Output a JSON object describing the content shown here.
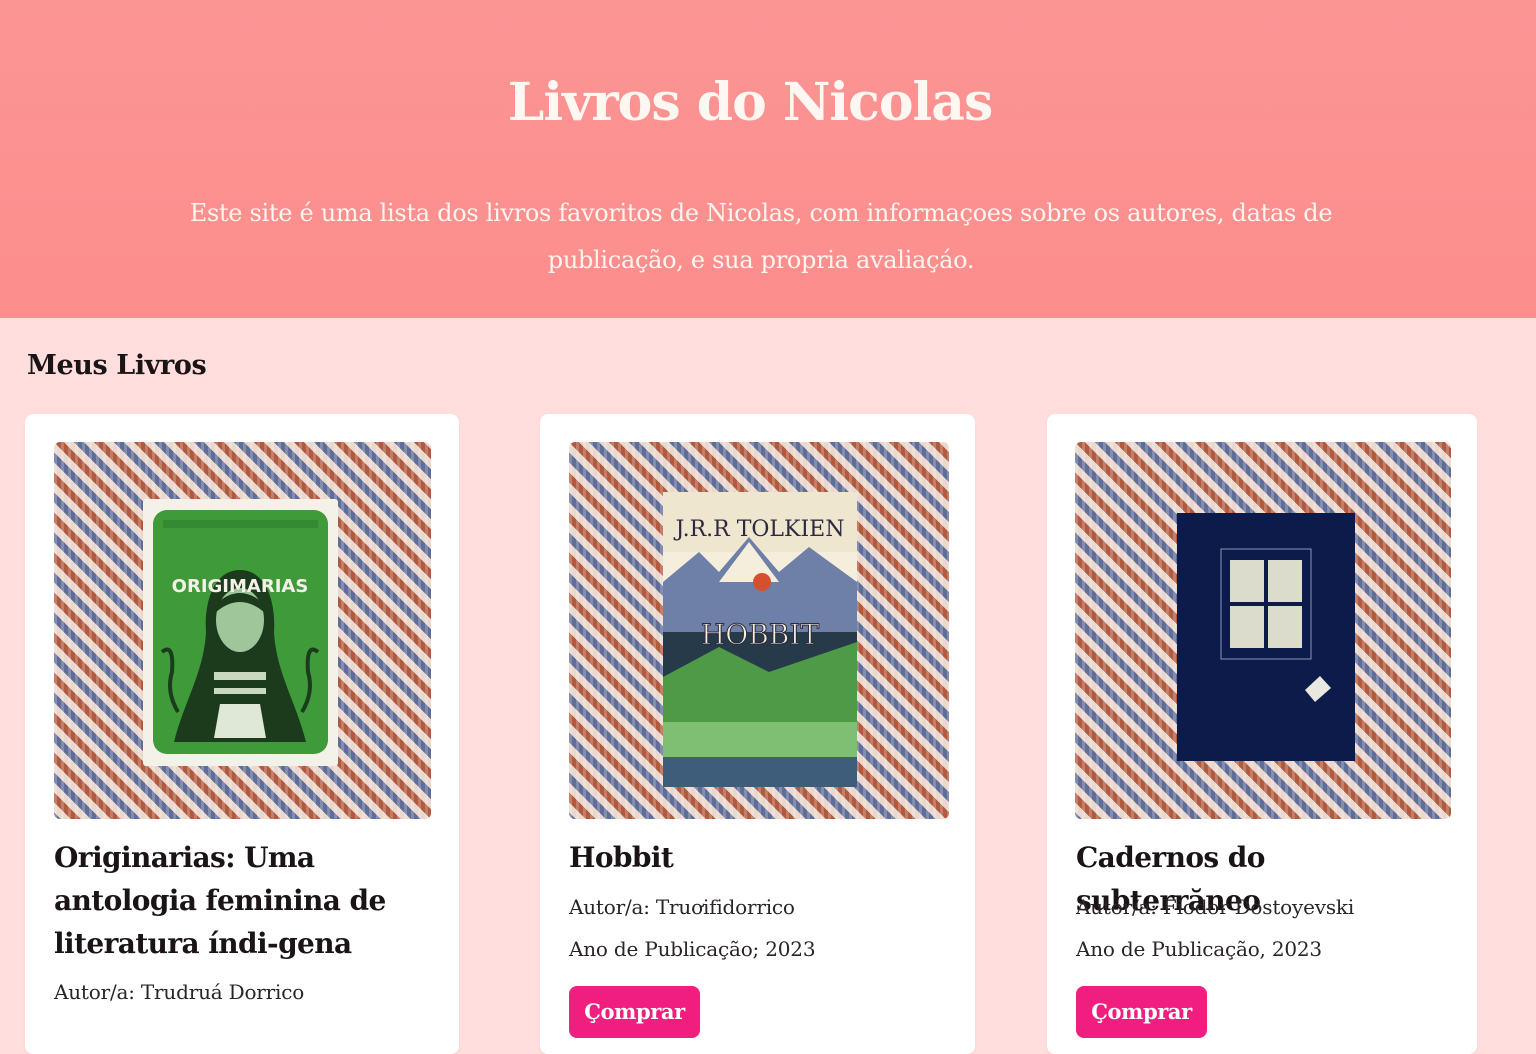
{
  "header": {
    "title": "Livros do Nicolas",
    "description": "Este site é uma lista dos livros favoritos de Nicolas, com informaçoes sobre os autores, datas de publicação, e sua propria avaliaçáo."
  },
  "main": {
    "section_title": "Meus Livros",
    "books": [
      {
        "title": "Originarias: Uma antologia feminina de literatura índi-gena",
        "author": "Autor/a: Trudruá Dorrico",
        "year": "",
        "buy_label": "",
        "cover_text": "ORIGIMARIAS"
      },
      {
        "title": "Hobbit",
        "author": "Autor/a: Truơifidorrico",
        "year": "Ano de Publicação; 2023",
        "buy_label": "Çomprar",
        "cover_text_author": "J.R.R TOLKIEN",
        "cover_text_title": "HOBBIT"
      },
      {
        "title": "Cadernos do subterrăneo",
        "author": "Autor/a: Fiodor Dostoyevski",
        "year": "Ano de Publicação, 2023",
        "buy_label": "Çomprar"
      }
    ]
  },
  "colors": {
    "header_bg": "#fb9291",
    "page_bg": "#ffdedd",
    "card_bg": "#ffffff",
    "button_bg": "#f01e7f"
  }
}
